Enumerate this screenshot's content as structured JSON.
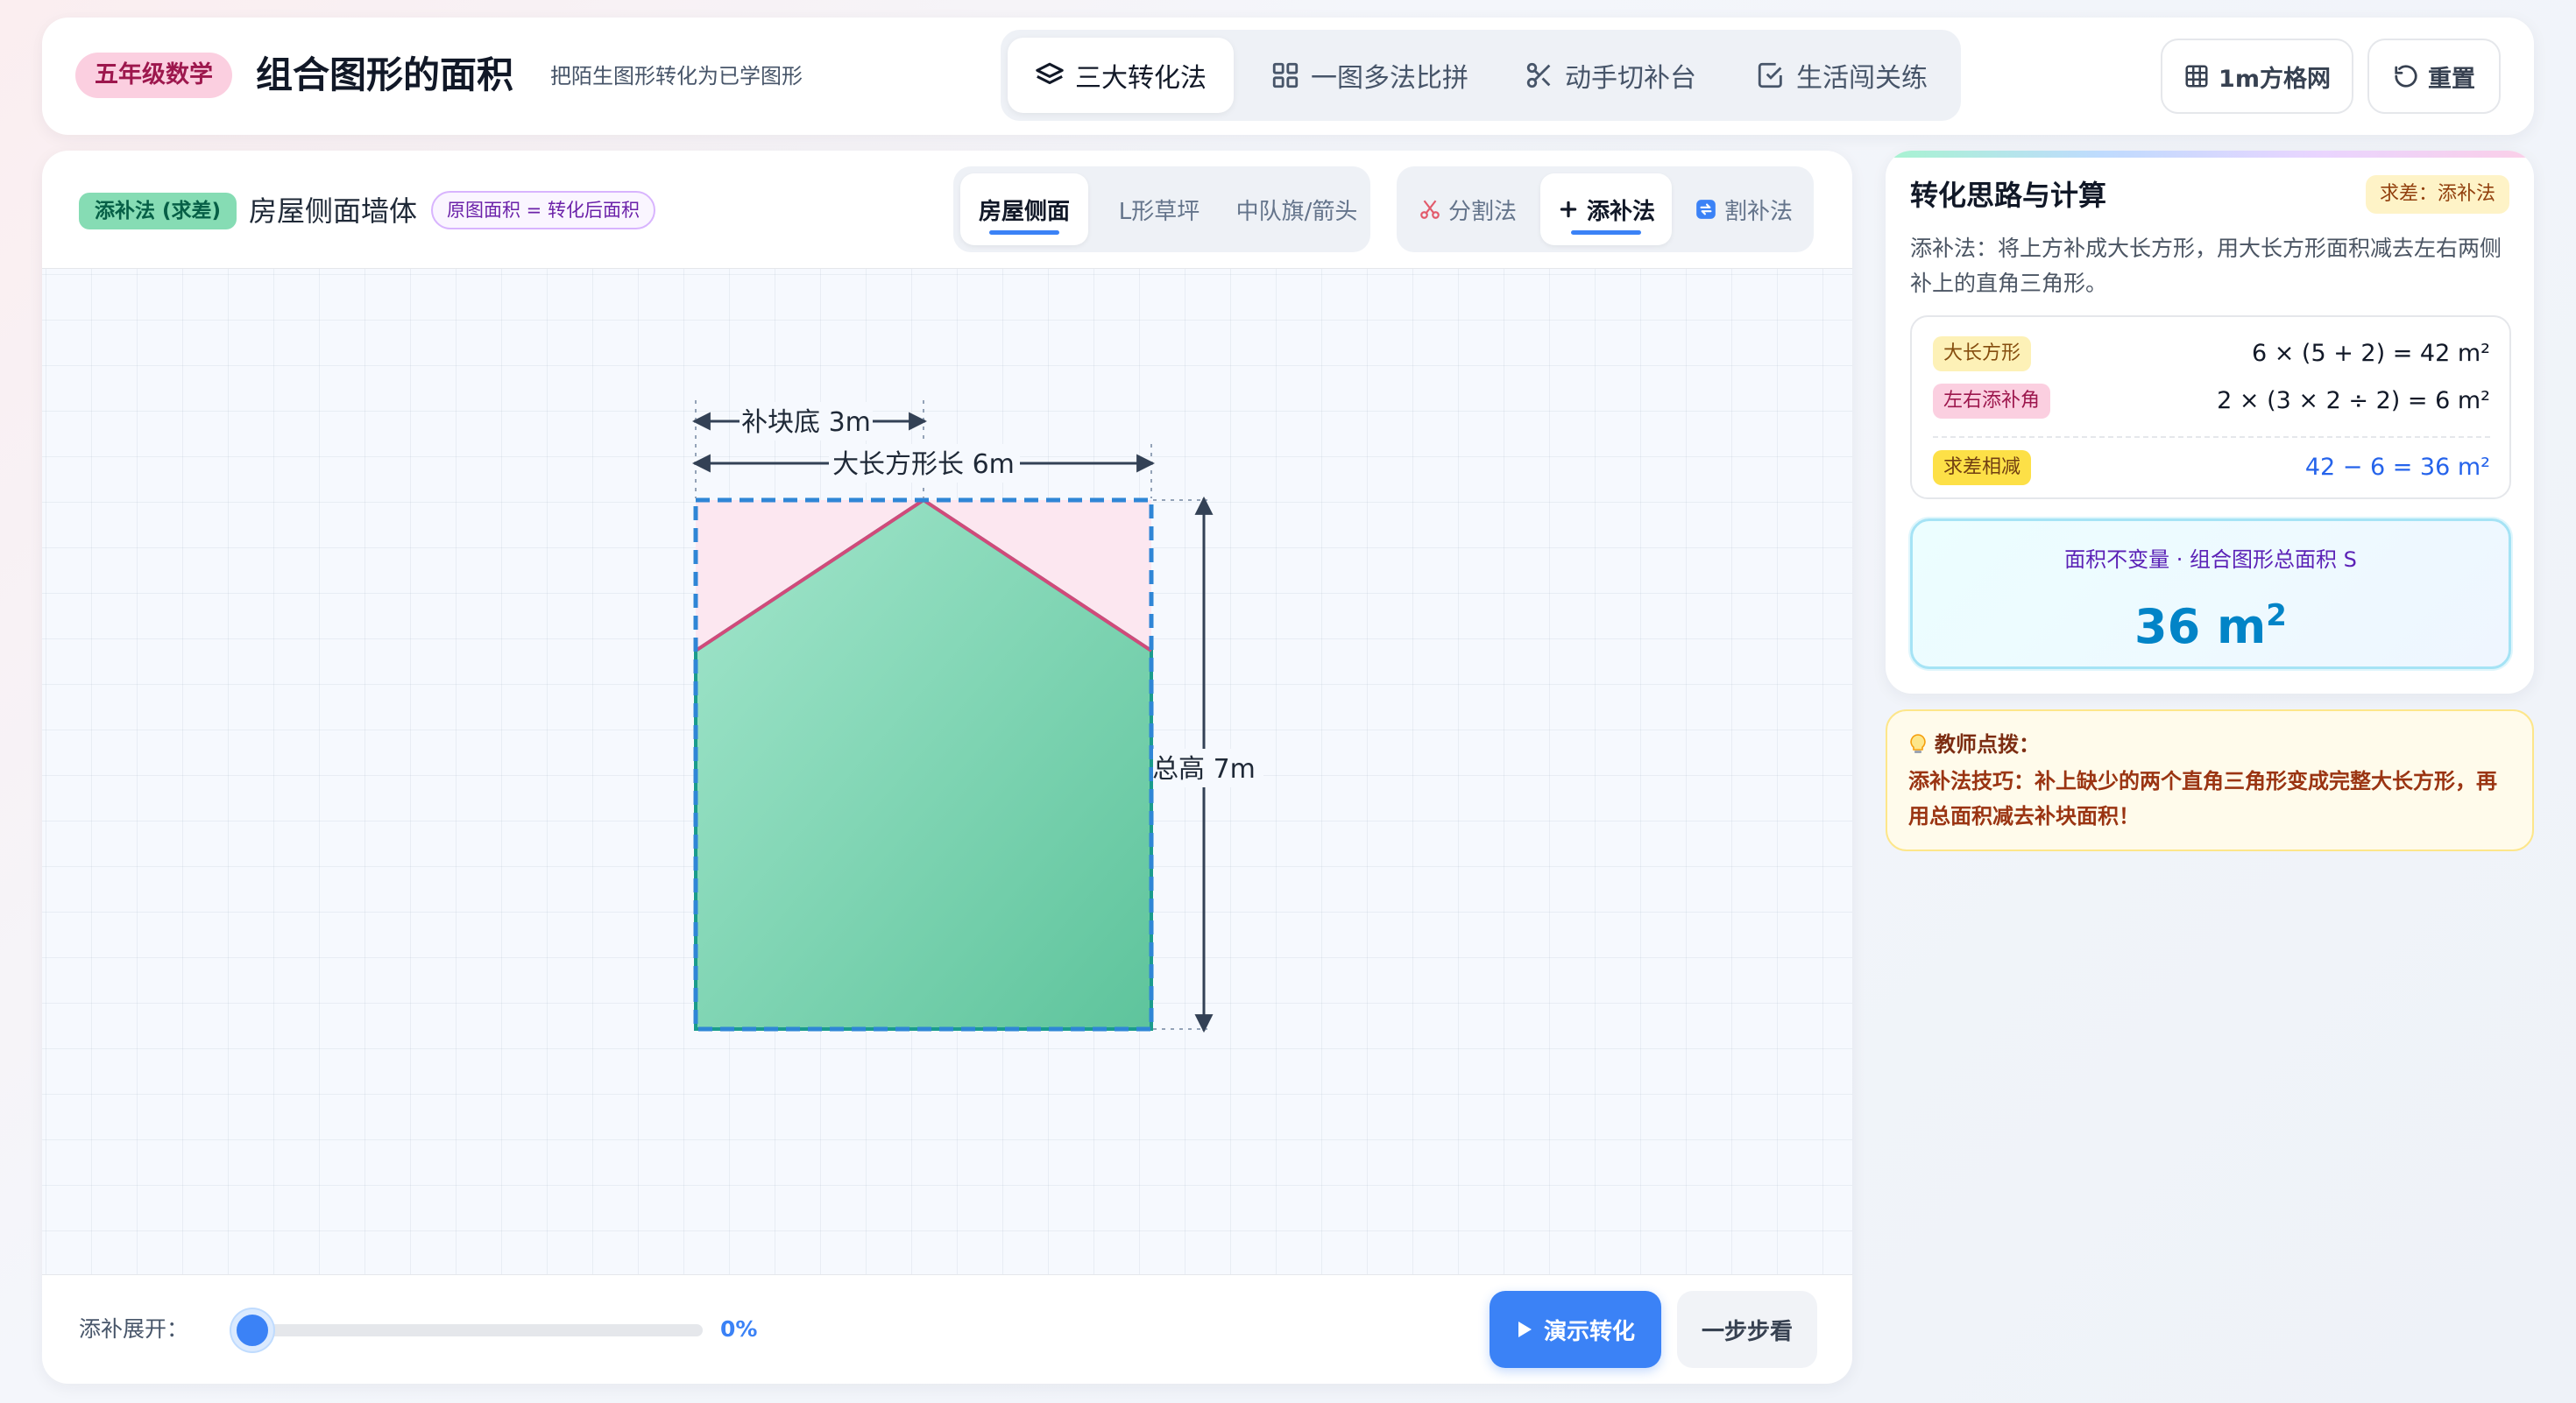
{
  "header": {
    "grade_badge": "五年级数学",
    "title": "组合图形的面积",
    "subtitle": "把陌生图形转化为已学图形",
    "tabs": [
      {
        "label": "三大转化法",
        "icon": "layers-icon",
        "active": true
      },
      {
        "label": "一图多法比拼",
        "icon": "grid-icon",
        "active": false
      },
      {
        "label": "动手切补台",
        "icon": "scissors-icon",
        "active": false
      },
      {
        "label": "生活闯关练",
        "icon": "checkbox-icon",
        "active": false
      }
    ],
    "grid_button": "1m方格网",
    "reset_button": "重置"
  },
  "workspace": {
    "method_badge": "添补法 (求差)",
    "shape_title": "房屋侧面墙体",
    "formula_tag": "原图面积 = 转化后面积",
    "shape_tabs": [
      "房屋侧面",
      "L形草坪",
      "中队旗/箭头"
    ],
    "active_shape": "房屋侧面",
    "method_tabs": [
      {
        "label": "分割法",
        "icon": "scissors-icon"
      },
      {
        "label": "添补法",
        "icon": "plus-icon"
      },
      {
        "label": "割补法",
        "icon": "swap-icon"
      }
    ],
    "active_method": "添补法",
    "figure": {
      "dim_patch_base": "补块底 3m",
      "dim_rect_length": "大长方形长 6m",
      "dim_total_height": "总高 7m",
      "colors": {
        "house_fill_top": "#a3e6cc",
        "house_fill_bottom": "#5ec49c",
        "patch_fill": "#fce7f0",
        "patch_stroke": "#d14a7a",
        "rect_outline": "#2f86d6",
        "house_outline": "#1a9c8c"
      }
    },
    "slider": {
      "label": "添补展开：",
      "value_text": "0%",
      "value": 0
    },
    "play_button": "演示转化",
    "step_button": "一步步看"
  },
  "panel": {
    "title": "转化思路与计算",
    "goal_tag": "求差：添补法",
    "description": "添补法：将上方补成大长方形，用大长方形面积减去左右两侧补上的直角三角形。",
    "rows": [
      {
        "tag": "大长方形",
        "expr": "6 × (5 + 2) = 42 m²"
      },
      {
        "tag": "左右添补角",
        "expr": "2 × (3 × 2 ÷ 2) = 6 m²"
      },
      {
        "tag": "求差相减",
        "expr": "42 − 6 = 36 m²"
      }
    ],
    "result_label": "面积不变量 · 组合图形总面积 S",
    "result_number": "36 m",
    "result_unit_power": "2"
  },
  "tip": {
    "title": "教师点拨：",
    "text": "添补法技巧：补上缺少的两个直角三角形变成完整大长方形，再用总面积减去补块面积！"
  }
}
